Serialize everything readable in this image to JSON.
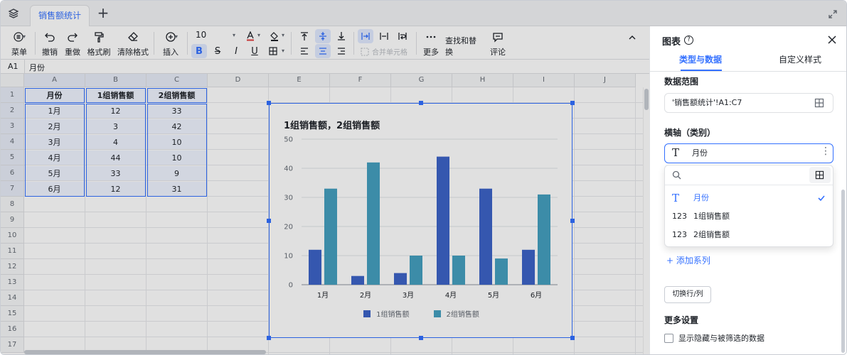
{
  "tabbar": {
    "tab_label": "销售额统计"
  },
  "toolbar": {
    "menu": "菜单",
    "undo": "撤销",
    "redo": "重做",
    "format_painter": "格式刷",
    "clear_format": "清除格式",
    "insert": "插入",
    "font_size": "10",
    "merge_cells": "合并单元格",
    "more": "更多",
    "find_replace": "查找和替换",
    "comment": "评论"
  },
  "formula_bar": {
    "cell_ref": "A1",
    "content": "月份"
  },
  "grid": {
    "columns": [
      "A",
      "B",
      "C",
      "D",
      "E",
      "F",
      "G",
      "H",
      "I",
      "J"
    ],
    "rows": [
      "1",
      "2",
      "3",
      "4",
      "5",
      "6",
      "7",
      "8",
      "9",
      "10",
      "11",
      "12",
      "13",
      "14",
      "15",
      "16",
      "17"
    ],
    "table": [
      [
        "月份",
        "1组销售额",
        "2组销售额"
      ],
      [
        "1月",
        "12",
        "33"
      ],
      [
        "2月",
        "3",
        "42"
      ],
      [
        "3月",
        "4",
        "10"
      ],
      [
        "4月",
        "44",
        "10"
      ],
      [
        "5月",
        "33",
        "9"
      ],
      [
        "6月",
        "12",
        "31"
      ]
    ]
  },
  "chart_data": {
    "type": "bar",
    "title": "1组销售额，2组销售额",
    "categories": [
      "1月",
      "2月",
      "3月",
      "4月",
      "5月",
      "6月"
    ],
    "series": [
      {
        "name": "1组销售额",
        "values": [
          12,
          3,
          4,
          44,
          33,
          12
        ],
        "color": "#3d63c8"
      },
      {
        "name": "2组销售额",
        "values": [
          33,
          42,
          10,
          10,
          9,
          31
        ],
        "color": "#45a0c0"
      }
    ],
    "yticks": [
      "0",
      "10",
      "20",
      "30",
      "40",
      "50"
    ],
    "ylim": [
      0,
      50
    ],
    "grid": true,
    "legend_position": "bottom"
  },
  "panel": {
    "title": "图表",
    "tab_type_data": "类型与数据",
    "tab_custom_style": "自定义样式",
    "data_range_label": "数据范围",
    "data_range_value": "'销售额统计'!A1:C7",
    "x_axis_label": "横轴（类别）",
    "x_axis_value": "月份",
    "dropdown_items": [
      {
        "icon": "T",
        "label": "月份",
        "selected": true
      },
      {
        "icon": "123",
        "label": "1组销售额",
        "selected": false
      },
      {
        "icon": "123",
        "label": "2组销售额",
        "selected": false
      }
    ],
    "add_series": "+ 添加系列",
    "switch_row_col": "切换行/列",
    "more_settings": "更多设置",
    "show_hidden": "显示隐藏与被筛选的数据"
  },
  "colors": {
    "accent": "#3370ff"
  }
}
